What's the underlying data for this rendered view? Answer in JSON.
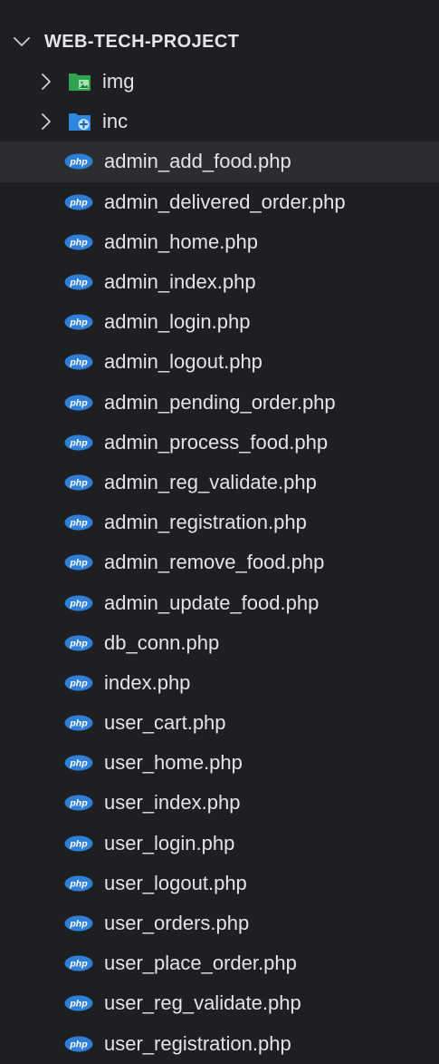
{
  "explorer": {
    "root_title": "WEB-TECH-PROJECT",
    "folders": [
      {
        "label": "img",
        "icon": "image-folder-icon",
        "color": "#2ea44f"
      },
      {
        "label": "inc",
        "icon": "include-folder-icon",
        "color": "#2d86e0"
      }
    ],
    "files": [
      {
        "label": "admin_add_food.php",
        "selected": true
      },
      {
        "label": "admin_delivered_order.php"
      },
      {
        "label": "admin_home.php"
      },
      {
        "label": "admin_index.php"
      },
      {
        "label": "admin_login.php"
      },
      {
        "label": "admin_logout.php"
      },
      {
        "label": "admin_pending_order.php"
      },
      {
        "label": "admin_process_food.php"
      },
      {
        "label": "admin_reg_validate.php"
      },
      {
        "label": "admin_registration.php"
      },
      {
        "label": "admin_remove_food.php"
      },
      {
        "label": "admin_update_food.php"
      },
      {
        "label": "db_conn.php"
      },
      {
        "label": "index.php"
      },
      {
        "label": "user_cart.php"
      },
      {
        "label": "user_home.php"
      },
      {
        "label": "user_index.php"
      },
      {
        "label": "user_login.php"
      },
      {
        "label": "user_logout.php"
      },
      {
        "label": "user_orders.php"
      },
      {
        "label": "user_place_order.php"
      },
      {
        "label": "user_reg_validate.php"
      },
      {
        "label": "user_registration.php"
      }
    ],
    "php_icon_color": "#2f7fd9",
    "php_icon_text": "php"
  }
}
